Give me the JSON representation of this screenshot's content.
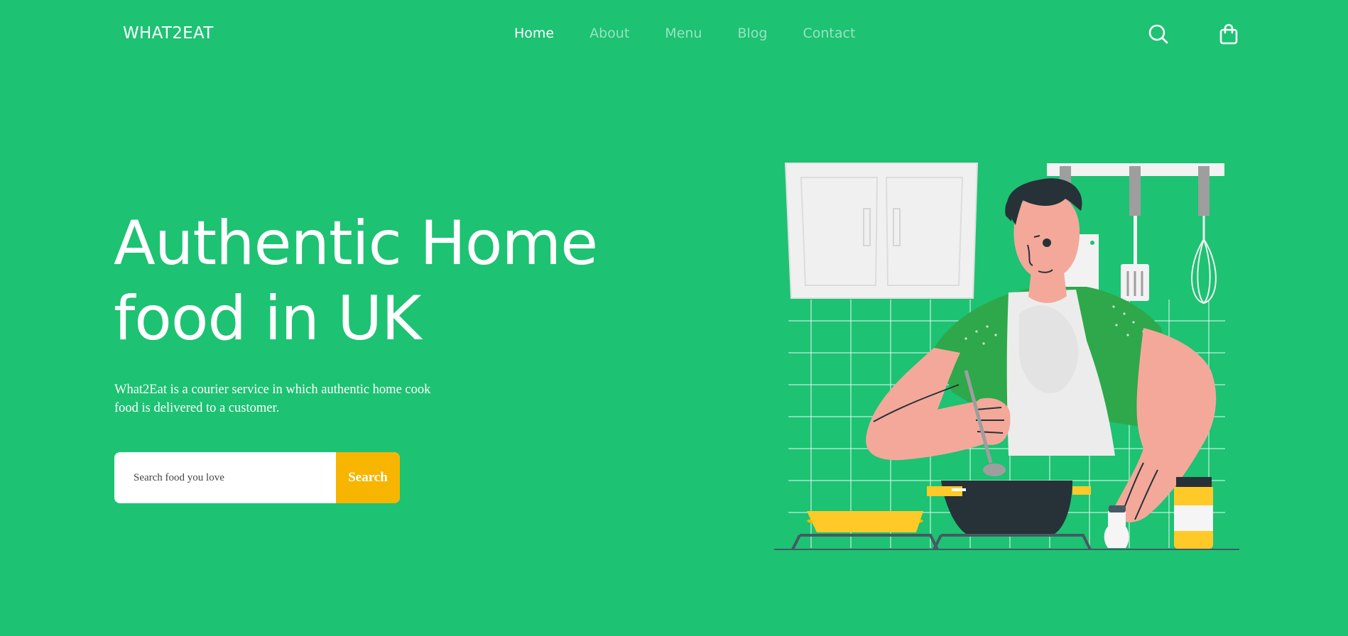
{
  "header": {
    "logo": "WHAT2EAT",
    "nav": [
      "Home",
      "About",
      "Menu",
      "Blog",
      "Contact"
    ],
    "active_nav": "Home",
    "icons": [
      "search-icon",
      "shopping-bag-icon"
    ]
  },
  "hero": {
    "title_line1": "Authentic Home",
    "title_line2": "food in UK",
    "description": "What2Eat is a courier service in which authentic home cook food is delivered to a customer.",
    "search": {
      "placeholder": "Search food you love",
      "value": "",
      "button_label": "Search"
    }
  },
  "colors": {
    "background": "#1dc273",
    "accent": "#f7b500",
    "text": "#ffffff"
  }
}
